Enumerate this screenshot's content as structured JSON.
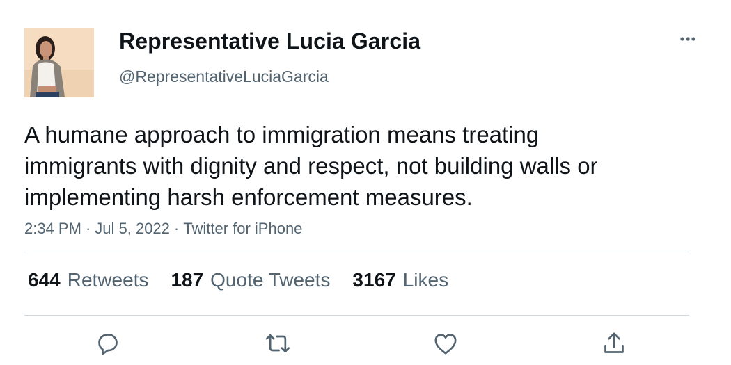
{
  "author": {
    "name": "Representative Lucia Garcia",
    "handle": "@RepresentativeLuciaGarcia",
    "avatar_icon": "profile-photo"
  },
  "tweet": {
    "text": "A humane approach to immigration means treating immigrants with dignity and respect, not building walls or implementing harsh enforcement measures.",
    "time": "2:34 PM",
    "date": "Jul 5, 2022",
    "source": "Twitter for iPhone",
    "separator": "·"
  },
  "stats": {
    "retweets_count": "644",
    "retweets_label": "Retweets",
    "quotes_count": "187",
    "quotes_label": "Quote Tweets",
    "likes_count": "3167",
    "likes_label": "Likes"
  },
  "icons": {
    "more": "more-horizontal-icon",
    "reply": "reply-icon",
    "retweet": "retweet-icon",
    "like": "heart-icon",
    "share": "share-icon"
  },
  "colors": {
    "text": "#0f1419",
    "secondary": "#536471",
    "divider": "#cfd9de",
    "avatar_bg": "#f6dcc0"
  }
}
